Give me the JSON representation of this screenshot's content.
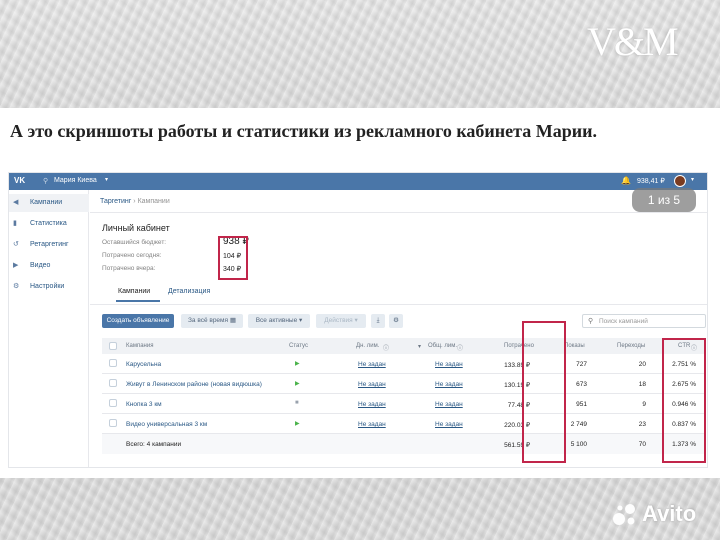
{
  "brand": {
    "logo_text": "V&M",
    "watermark": "Avito"
  },
  "caption": "А это скриншоты работы и статистики из рекламного кабинета Марии.",
  "slide_counter": "1 из 5",
  "topbar": {
    "user_name": "Мария Киева",
    "balance": "938,41 ₽"
  },
  "sidebar": {
    "items": [
      {
        "label": "Кампании",
        "icon": "megaphone-icon",
        "active": true
      },
      {
        "label": "Статистика",
        "icon": "bar-chart-icon",
        "active": false
      },
      {
        "label": "Ретаргетинг",
        "icon": "retarget-icon",
        "active": false
      },
      {
        "label": "Видео",
        "icon": "video-icon",
        "active": false
      },
      {
        "label": "Настройки",
        "icon": "gear-icon",
        "active": false
      }
    ]
  },
  "breadcrumb": {
    "root": "Таргетинг",
    "current": "Кампании"
  },
  "account": {
    "title": "Личный кабинет",
    "budget_left_label": "Оставшийся бюджет:",
    "budget_left_value": "938 ₽",
    "spent_today_label": "Потрачено сегодня:",
    "spent_today_value": "104 ₽",
    "spent_yesterday_label": "Потрачено вчера:",
    "spent_yesterday_value": "340 ₽"
  },
  "tabs": {
    "campaigns": "Кампании",
    "details": "Детализация"
  },
  "toolbar": {
    "create_label": "Создать объявление",
    "period_label": "За всё время",
    "filter_label": "Все активные",
    "actions_label": "Действия",
    "search_placeholder": "Поиск кампаний"
  },
  "table": {
    "headers": {
      "campaign": "Кампания",
      "status": "Статус",
      "daily_limit": "Дн. лим.",
      "total_limit": "Общ. лим.",
      "spent": "Потрачено",
      "shows": "Показы",
      "clicks": "Переходы",
      "ctr": "CTR"
    },
    "rows": [
      {
        "name": "Карусельна",
        "status": "▶",
        "status_color": "#4bb34b",
        "daily_limit": "Не задан",
        "total_limit": "Не задан",
        "spent": "133.89 ₽",
        "shows": "727",
        "clicks": "20",
        "ctr": "2.751 %"
      },
      {
        "name": "Живут в Ленинском районе (новая видюшка)",
        "status": "▶",
        "status_color": "#4bb34b",
        "daily_limit": "Не задан",
        "total_limit": "Не задан",
        "spent": "130.19 ₽",
        "shows": "673",
        "clicks": "18",
        "ctr": "2.675 %"
      },
      {
        "name": "Кнопка 3 км",
        "status": "■",
        "status_color": "#99a2ad",
        "daily_limit": "Не задан",
        "total_limit": "Не задан",
        "spent": "77.48 ₽",
        "shows": "951",
        "clicks": "9",
        "ctr": "0.946 %"
      },
      {
        "name": "Видео универсальная 3 км",
        "status": "▶",
        "status_color": "#4bb34b",
        "daily_limit": "Не задан",
        "total_limit": "Не задан",
        "spent": "220.03 ₽",
        "shows": "2 749",
        "clicks": "23",
        "ctr": "0.837 %"
      }
    ],
    "total": {
      "label": "Всего: 4 кампании",
      "spent": "561.59 ₽",
      "shows": "5 100",
      "clicks": "70",
      "ctr": "1.373 %"
    }
  },
  "colors": {
    "vk_blue": "#4a76a8",
    "highlight_red": "#c1254a"
  }
}
